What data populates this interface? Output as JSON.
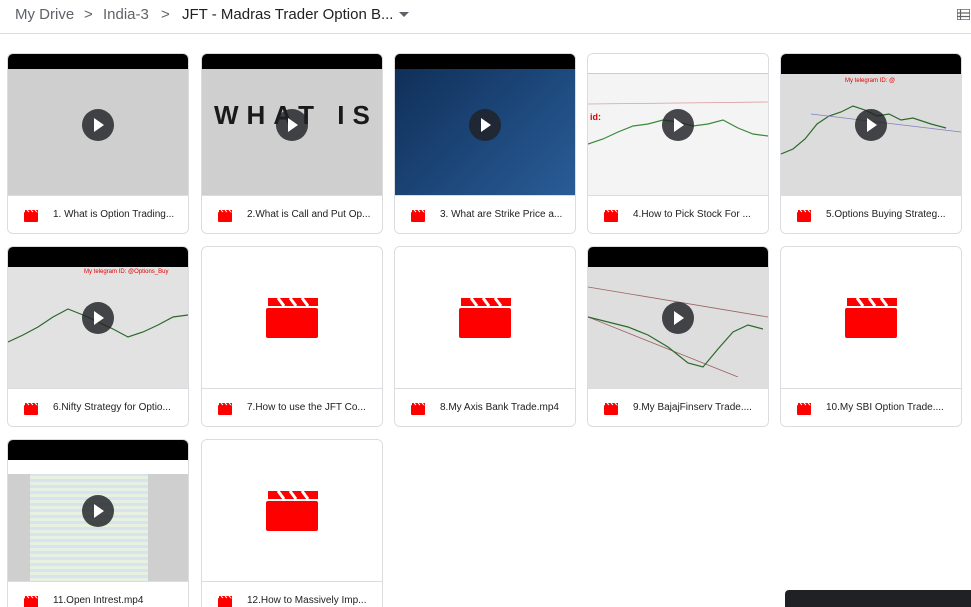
{
  "breadcrumb": {
    "items": [
      "My Drive",
      "India-3",
      "JFT - Madras Trader Option B..."
    ],
    "separator": ">"
  },
  "toolbar": {
    "view_toggle_icon": "list-view-icon"
  },
  "colors": {
    "video_red": "#ff0000",
    "thumb_gray": "#cfcfcf",
    "thumb_blue": "#1e4a7e"
  },
  "files": [
    {
      "name": "1. What is Option Trading..."
    },
    {
      "name": "2.What is Call and Put Op..."
    },
    {
      "name": "3. What are Strike Price a...",
      "thumb_text": ""
    },
    {
      "name": "4.How to Pick Stock For ...",
      "thumb_text": "id:"
    },
    {
      "name": "5.Options Buying Strateg...",
      "thumb_text": "My telegram ID: @"
    },
    {
      "name": "6.Nifty Strategy for Optio...",
      "thumb_text": "My telegram ID: @Options_Buy"
    },
    {
      "name": "7.How to use the JFT Co..."
    },
    {
      "name": "8.My Axis Bank Trade.mp4"
    },
    {
      "name": "9.My BajajFinserv Trade...."
    },
    {
      "name": "10.My SBI Option Trade...."
    },
    {
      "name": "11.Open Intrest.mp4"
    },
    {
      "name": "12.How to Massively Imp..."
    }
  ],
  "thumb_text_2": "WHAT IS"
}
